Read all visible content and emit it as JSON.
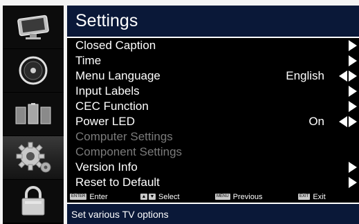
{
  "header": {
    "title": "Settings"
  },
  "menu": {
    "items": [
      {
        "label": "Closed Caption",
        "value": "",
        "disabled": false,
        "nav": "right"
      },
      {
        "label": "Time",
        "value": "",
        "disabled": false,
        "nav": "right"
      },
      {
        "label": "Menu Language",
        "value": "English",
        "disabled": false,
        "nav": "both"
      },
      {
        "label": "Input Labels",
        "value": "",
        "disabled": false,
        "nav": "right"
      },
      {
        "label": "CEC Function",
        "value": "",
        "disabled": false,
        "nav": "right"
      },
      {
        "label": "Power LED",
        "value": "On",
        "disabled": false,
        "nav": "both"
      },
      {
        "label": "Computer Settings",
        "value": "",
        "disabled": true,
        "nav": "none"
      },
      {
        "label": "Component Settings",
        "value": "",
        "disabled": true,
        "nav": "none"
      },
      {
        "label": "Version Info",
        "value": "",
        "disabled": false,
        "nav": "right"
      },
      {
        "label": "Reset to Default",
        "value": "",
        "disabled": false,
        "nav": "right"
      }
    ]
  },
  "hints": {
    "enter_key": "ENTER",
    "enter_label": "Enter",
    "select_label": "Select",
    "menu_key": "MENU",
    "previous_label": "Previous",
    "exit_key": "EXIT",
    "exit_label": "Exit"
  },
  "status": {
    "text": "Set various TV options"
  },
  "sidebar": {
    "icons": [
      {
        "name": "picture-icon",
        "active": false
      },
      {
        "name": "audio-icon",
        "active": false
      },
      {
        "name": "channels-icon",
        "active": false
      },
      {
        "name": "settings-gear-icon",
        "active": true
      },
      {
        "name": "lock-icon",
        "active": false
      }
    ]
  },
  "colors": {
    "title_bg": "#0a1838",
    "menu_bg": "#000000",
    "text": "#ffffff",
    "disabled_text": "#7a7a7a"
  }
}
